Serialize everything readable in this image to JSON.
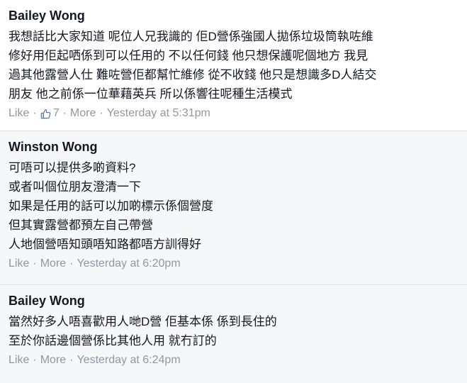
{
  "comments": [
    {
      "author": "Bailey Wong",
      "lines": [
        "我想話比大家知道 呢位人兄我識的 佢D營係強國人拋係垃圾筒執咗維",
        "修好用佢起哂係到可以任用的 不以任何錢 他只想保護呢個地方 我見",
        "過其他露營人仕 難咗營佢都幫忙維修 從不收錢 他只是想識多D人結交",
        "朋友 他之前係一位華藉英兵 所以係響往呢種生活模式"
      ],
      "like_label": "Like",
      "like_count": "7",
      "like_icon": "thumbs-up-icon",
      "more_label": "More",
      "timestamp": "Yesterday at 5:31pm",
      "separator": "·"
    },
    {
      "author": "Winston Wong",
      "lines": [
        "可唔可以提供多啲資料?",
        "或者叫個位朋友澄清一下",
        "如果是任用的話可以加啲標示係個營度",
        "但其實露營都預左自己帶營",
        "人地個營唔知頭唔知路都唔方訓得好"
      ],
      "like_label": "Like",
      "more_label": "More",
      "timestamp": "Yesterday at 6:20pm",
      "separator": "·"
    },
    {
      "author": "Bailey Wong",
      "lines": [
        "當然好多人唔喜歡用人哋D營 佢基本係 係到長住的",
        "至於你話邊個營係比其他人用 就冇訂的"
      ],
      "like_label": "Like",
      "more_label": "More",
      "timestamp": "Yesterday at 6:24pm",
      "separator": "·"
    }
  ],
  "colors": {
    "text": "#141823",
    "meta": "#9197a3",
    "alt_background": "#f6f7f8",
    "divider": "#e1e2e3"
  }
}
